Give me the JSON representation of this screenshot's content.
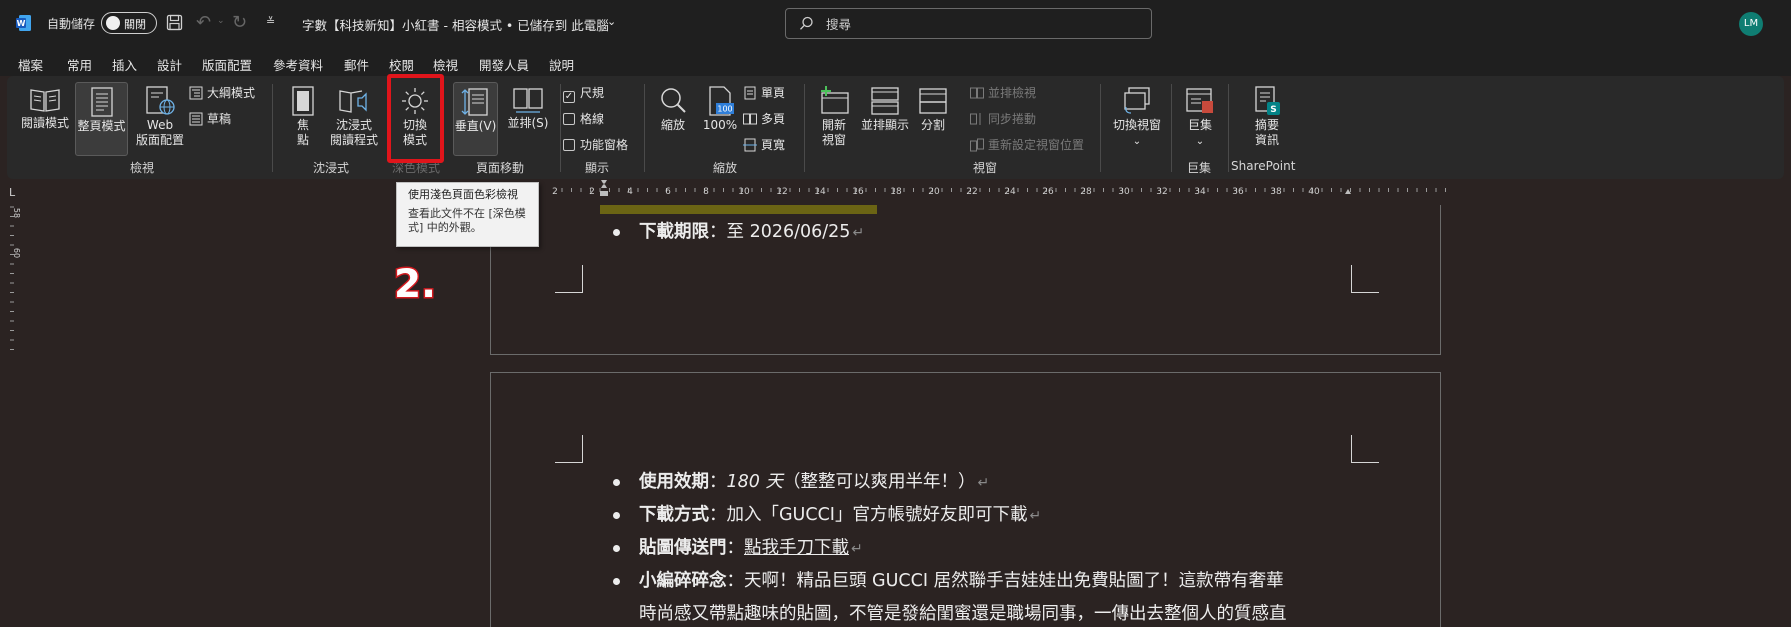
{
  "titlebar": {
    "autosave_label": "自動儲存",
    "autosave_state": "關閉",
    "doc_title": "字數【科技新知】小紅書 - 相容模式 • 已儲存到 此電腦",
    "search_placeholder": "搜尋",
    "avatar_initials": "LM"
  },
  "menu": {
    "tabs": [
      "檔案",
      "常用",
      "插入",
      "設計",
      "版面配置",
      "參考資料",
      "郵件",
      "校閱",
      "檢視",
      "開發人員",
      "說明"
    ],
    "active_tab": "檢視"
  },
  "ribbon": {
    "views": {
      "read_mode": "閱讀模式",
      "print_layout": "整頁模式",
      "web_layout_1": "Web",
      "web_layout_2": "版面配置",
      "outline": "大綱模式",
      "draft": "草稿",
      "group": "檢視"
    },
    "immersive": {
      "focus_1": "焦",
      "focus_2": "點",
      "reader_1": "沈浸式",
      "reader_2": "閱讀程式",
      "group": "沈浸式"
    },
    "dark_mode": {
      "switch_1": "切換",
      "switch_2": "模式",
      "group": "深色模式"
    },
    "page_movement": {
      "vertical": "垂直(V)",
      "side_to_side": "並排(S)",
      "group": "頁面移動"
    },
    "show": {
      "ruler": "尺規",
      "gridlines": "格線",
      "nav_pane": "功能窗格",
      "ruler_checked": "✓",
      "group": "顯示"
    },
    "zoom": {
      "zoom": "縮放",
      "hundred": "100%",
      "hundred_icon": "100",
      "one_page": "單頁",
      "multiple_pages": "多頁",
      "page_width": "頁寬",
      "group": "縮放"
    },
    "window": {
      "new_window_1": "開新",
      "new_window_2": "視窗",
      "arrange_all": "並排顯示",
      "split": "分割",
      "view_side_by_side": "並排檢視",
      "sync_scroll": "同步捲動",
      "reset_position": "重新設定視窗位置",
      "switch_windows": "切換視窗",
      "group": "視窗"
    },
    "macros": {
      "macros": "巨集",
      "group": "巨集"
    },
    "sharepoint": {
      "summary_1": "摘要",
      "summary_2": "資訊",
      "group": "SharePoint"
    }
  },
  "tooltip": {
    "title": "使用淺色頁面色彩檢視",
    "body": "查看此文件不在 [深色模式] 中的外觀。"
  },
  "annotation": {
    "step": "2."
  },
  "ruler": {
    "corner": "L",
    "h_ticks": [
      "2",
      "2",
      "4",
      "6",
      "8",
      "10",
      "12",
      "14",
      "16",
      "18",
      "20",
      "22",
      "24",
      "26",
      "28",
      "30",
      "32",
      "34",
      "36",
      "38",
      "40"
    ],
    "v_ticks": [
      "58",
      "60"
    ]
  },
  "document": {
    "page1": {
      "line1_bold": "下載期限",
      "line1_text": "：至 2026/06/25"
    },
    "page2": {
      "l1_bold": "使用效期",
      "l1_sep": "：",
      "l1_italic": "180 天",
      "l1_rest": "（整整可以爽用半年！）",
      "l2_bold": "下載方式",
      "l2_text": "：加入「GUCCI」官方帳號好友即可下載",
      "l3_bold": "貼圖傳送門",
      "l3_sep": "：",
      "l3_link": "點我手刀下載",
      "l4_bold": "小編碎碎念",
      "l4_text": "：天啊！精品巨頭 GUCCI 居然聯手吉娃娃出免費貼圖了！這款帶有奢華",
      "l5_text": "時尚感又帶點趣味的貼圖，不管是發給閨蜜還是職場同事，一傳出去整個人的質感直"
    }
  },
  "colors": {
    "accent": "#4aa3df",
    "highlight": "#e0151b",
    "avatar": "#0f7d72",
    "word_blue": "#185abd"
  }
}
